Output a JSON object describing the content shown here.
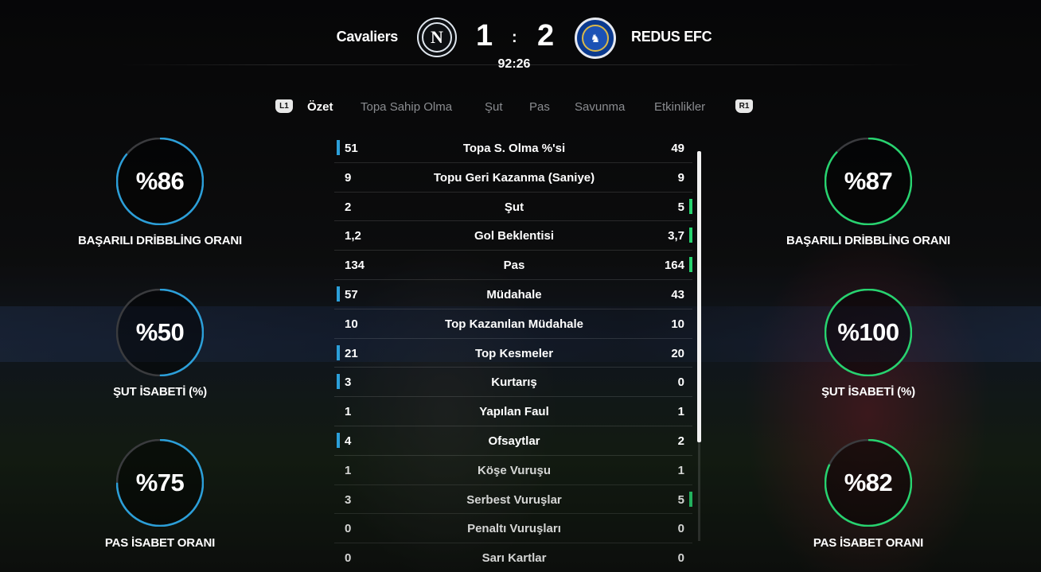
{
  "colors": {
    "home_accent": "#2b9fd9",
    "away_accent": "#27d36f",
    "track": "#3a3b3e"
  },
  "match": {
    "home_team": "Cavaliers",
    "away_team": "REDUS EFC",
    "home_badge_letter": "N",
    "away_badge_icon": "lion-crest-icon",
    "home_score": "1",
    "separator": ":",
    "away_score": "2",
    "clock": "92:26"
  },
  "tabs": {
    "left_hint": "L1",
    "right_hint": "R1",
    "items": [
      "Özet",
      "Topa Sahip Olma",
      "Şut",
      "Pas",
      "Savunma",
      "Etkinlikler"
    ],
    "active_index": 0
  },
  "home_stats": [
    {
      "value": "%86",
      "percent": 86,
      "label": "BAŞARILI DRİBBLİNG ORANI"
    },
    {
      "value": "%50",
      "percent": 50,
      "label": "ŞUT İSABETİ (%)"
    },
    {
      "value": "%75",
      "percent": 75,
      "label": "PAS İSABET ORANI"
    }
  ],
  "away_stats": [
    {
      "value": "%87",
      "percent": 87,
      "label": "BAŞARILI DRİBBLİNG ORANI"
    },
    {
      "value": "%100",
      "percent": 100,
      "label": "ŞUT İSABETİ (%)"
    },
    {
      "value": "%82",
      "percent": 82,
      "label": "PAS İSABET ORANI"
    }
  ],
  "rows": [
    {
      "home": "51",
      "label": "Topa S. Olma %'si",
      "away": "49",
      "leader": "home"
    },
    {
      "home": "9",
      "label": "Topu Geri Kazanma (Saniye)",
      "away": "9",
      "leader": "none"
    },
    {
      "home": "2",
      "label": "Şut",
      "away": "5",
      "leader": "away"
    },
    {
      "home": "1,2",
      "label": "Gol Beklentisi",
      "away": "3,7",
      "leader": "away"
    },
    {
      "home": "134",
      "label": "Pas",
      "away": "164",
      "leader": "away"
    },
    {
      "home": "57",
      "label": "Müdahale",
      "away": "43",
      "leader": "home"
    },
    {
      "home": "10",
      "label": "Top Kazanılan Müdahale",
      "away": "10",
      "leader": "none"
    },
    {
      "home": "21",
      "label": "Top Kesmeler",
      "away": "20",
      "leader": "home"
    },
    {
      "home": "3",
      "label": "Kurtarış",
      "away": "0",
      "leader": "home"
    },
    {
      "home": "1",
      "label": "Yapılan Faul",
      "away": "1",
      "leader": "none"
    },
    {
      "home": "4",
      "label": "Ofsaytlar",
      "away": "2",
      "leader": "home"
    },
    {
      "home": "1",
      "label": "Köşe Vuruşu",
      "away": "1",
      "leader": "none"
    },
    {
      "home": "3",
      "label": "Serbest Vuruşlar",
      "away": "5",
      "leader": "away"
    },
    {
      "home": "0",
      "label": "Penaltı Vuruşları",
      "away": "0",
      "leader": "none"
    },
    {
      "home": "0",
      "label": "Sarı Kartlar",
      "away": "0",
      "leader": "none"
    }
  ]
}
